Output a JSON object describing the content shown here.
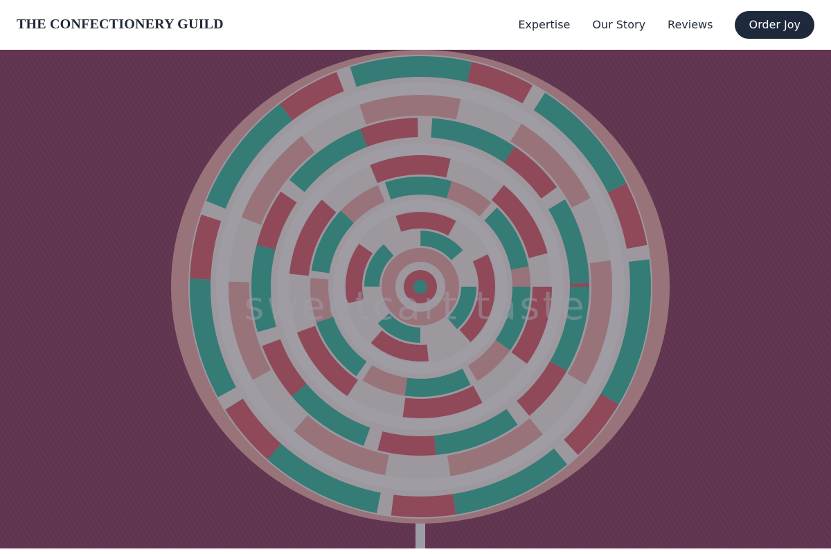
{
  "header": {
    "brand": "THE CONFECTIONERY GUILD",
    "nav": [
      {
        "label": "Expertise"
      },
      {
        "label": "Our Story"
      },
      {
        "label": "Reviews"
      }
    ],
    "cta_label": "Order Joy"
  },
  "hero": {
    "heading": "sweetcart taste",
    "image_subject": "swirl lollipop",
    "colors": {
      "background": "#8a3f5f",
      "candy_pink": "#d9606f",
      "candy_teal": "#3fb5a0",
      "candy_white": "#f5eeee",
      "candy_blush": "#e8a8a8"
    }
  },
  "colors": {
    "cta_background": "#1e293b",
    "text": "#1f2937"
  }
}
